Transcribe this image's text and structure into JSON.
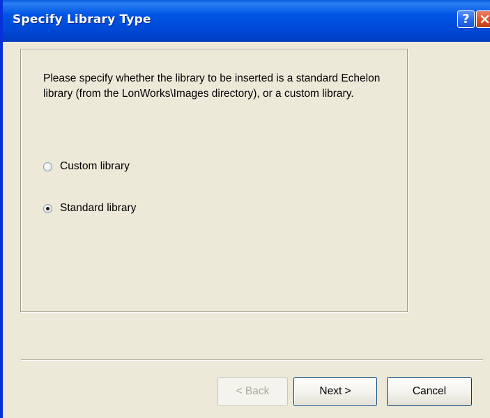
{
  "window": {
    "title": "Specify Library Type",
    "help_glyph": "?"
  },
  "content": {
    "instruction": "Please specify whether the library to be inserted is a standard Echelon library (from the LonWorks\\Images directory), or a custom library."
  },
  "options": [
    {
      "label": "Custom library",
      "checked": false
    },
    {
      "label": "Standard library",
      "checked": true
    }
  ],
  "buttons": {
    "back_label": "< Back",
    "back_enabled": false,
    "next_label": "Next >",
    "cancel_label": "Cancel"
  },
  "colors": {
    "titlebar": "#0055e5",
    "dialog_background": "#ece9d8",
    "close_button": "#e0522e"
  },
  "icons": [
    "help-icon",
    "close-icon"
  ]
}
